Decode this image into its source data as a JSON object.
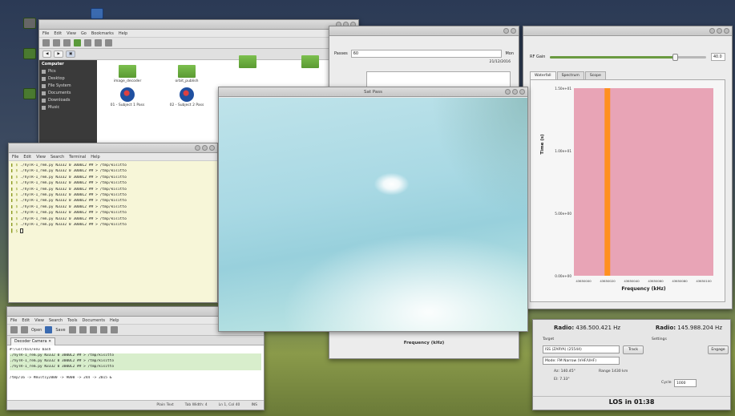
{
  "file_manager": {
    "menu": [
      "File",
      "Edit",
      "View",
      "Go",
      "Bookmarks",
      "Help"
    ],
    "sidebar_heading": "Computer",
    "sidebar_items": [
      "Pics",
      "Desktop",
      "File System",
      "Documents",
      "Downloads",
      "Music"
    ],
    "items": [
      {
        "label": "image_decoder",
        "kind": "folder"
      },
      {
        "label": "orbit_publish",
        "kind": "folder"
      },
      {
        "label": "01 - Subject 1 Pass",
        "kind": "badge"
      },
      {
        "label": "02 - Subject 2 Pass",
        "kind": "badge"
      }
    ]
  },
  "terminal": {
    "menu": [
      "File",
      "Edit",
      "View",
      "Search",
      "Terminal",
      "Help"
    ],
    "lines": [
      "./hyTR-1_rem.py N3332 0 3000L2 ## > /tmp/kisitto",
      "./hyTR-1_rem.py N3332 0 3000L2 ## > /tmp/kisitto",
      "./hyTR-1_rem.py N3332 0 3000L2 ## > /tmp/kisitto",
      "./hyTR-1_rem.py N3332 0 3000L2 ## > /tmp/kisitto",
      "./hyTR-1_rem.py N3332 0 3000L2 ## > /tmp/kisitto",
      "./hyTR-1_rem.py N3332 0 3000L2 ## > /tmp/kisitto",
      "./hyTR-1_rem.py N3332 0 3000L2 ## > /tmp/kisitto",
      "./hyTR-1_rem.py N3332 0 3000L2 ## > /tmp/kisitto",
      "./hyTR-1_rem.py N3332 0 3000L2 ## > /tmp/kisitto",
      "./hyTR-1_rem.py N3332 0 3000L2 ## > /tmp/kisitto",
      "./hyTR-1_rem.py N3332 0 3000L2 ## > /tmp/kisitto"
    ]
  },
  "editor": {
    "menu": [
      "File",
      "Edit",
      "View",
      "Search",
      "Tools",
      "Documents",
      "Help"
    ],
    "toolbar": {
      "open": "Open",
      "save": "Save"
    },
    "tab": "Decoder Camera",
    "lines": [
      "#!/usr/bin/env bash",
      "./hyTR-1_rem.py N3332 0 3000L2 ## > /tmp/kisitto",
      "./hyTR-1_rem.py N3332 0 3000L2 ## > /tmp/kisitto",
      "./hyTR-1_rem.py N3332 0 3000L2 ## > /tmp/kisitto",
      "",
      "/tmp/16 -> #multiy2000 -> 9000 -> 244 -> 2015 &"
    ],
    "status": [
      "Plain Text",
      "Tab Width: 4",
      "Ln 1, Col 40",
      "INS"
    ]
  },
  "dialog": {
    "label": "Passes",
    "field_value": "60",
    "side_label": "Mon",
    "date": "21/12/2016",
    "footer": "Frequency (kHz)"
  },
  "viewer": {
    "title": "Sat Pass"
  },
  "spectrogram": {
    "gain_label": "RF Gain",
    "gain_value": "40.0",
    "gain_level": 0.8,
    "tabs": [
      "Waterfall",
      "Spectrum",
      "Scope"
    ],
    "active_tab": "Waterfall"
  },
  "tracker": {
    "radio_left_label": "Radio:",
    "radio_left_value": "436.500.421 Hz",
    "radio_right_label": "Radio:",
    "radio_right_value": "145.988.204 Hz",
    "target_label": "Target",
    "target_value": "ISS (ZARYA) (25544)",
    "track_button": "Track",
    "mode_value": "Mode: FM Narrow (VHF/UHF)",
    "settings_label": "Settings",
    "engage_button": "Engage",
    "az_label": "Az:",
    "az_value": "140.45°",
    "el_label": "El:",
    "el_value": "7.33°",
    "range_label": "Range",
    "range_value": "1430 km",
    "cycle_label": "Cycle",
    "cycle_value": "1000",
    "los_text": "LOS in 01:38"
  },
  "chart_data": {
    "type": "heatmap",
    "title": "",
    "xlabel": "Frequency (kHz)",
    "ylabel": "Time (s)",
    "y_ticks": [
      "1.50e+01",
      "1.00e+01",
      "5.00e+00",
      "0.00e+00"
    ],
    "x_ticks": [
      "43650000",
      "43650020",
      "43650040",
      "43650060",
      "43650080",
      "43650100"
    ],
    "background_color": "#e8a4b6",
    "signal": {
      "x_fraction": 0.22,
      "color": "#ff9020"
    }
  }
}
